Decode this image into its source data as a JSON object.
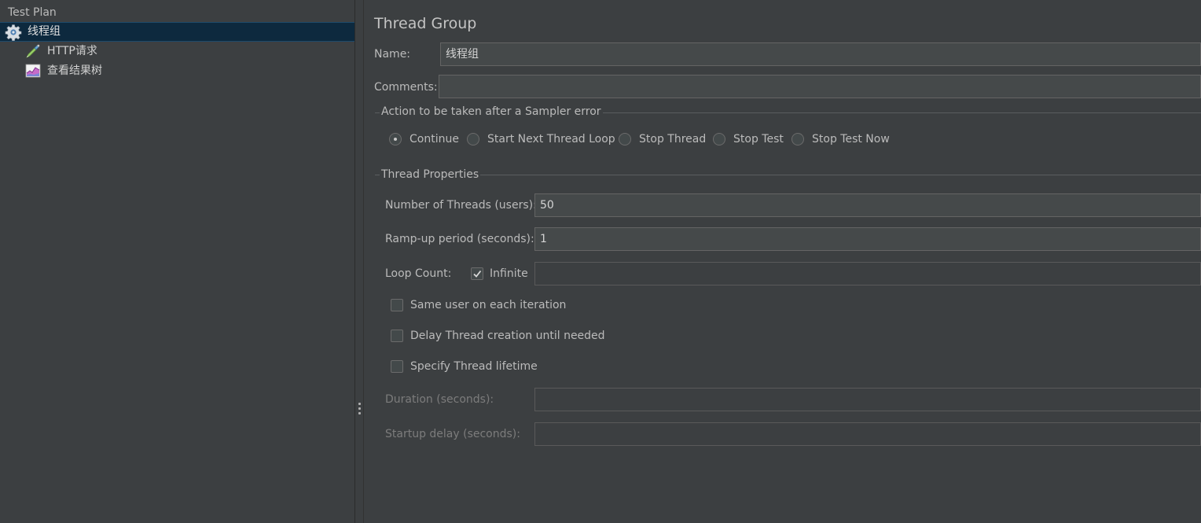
{
  "tree": {
    "root_label": "Test Plan",
    "items": [
      {
        "label": "线程组",
        "icon": "gear-icon"
      },
      {
        "label": "HTTP请求",
        "icon": "pipette-icon"
      },
      {
        "label": "查看结果树",
        "icon": "chart-icon"
      }
    ]
  },
  "panel": {
    "title": "Thread Group",
    "name_label": "Name:",
    "name_value": "线程组",
    "comments_label": "Comments:",
    "comments_value": "",
    "sampler_error": {
      "title": "Action to be taken after a Sampler error",
      "options": [
        "Continue",
        "Start Next Thread Loop",
        "Stop Thread",
        "Stop Test",
        "Stop Test Now"
      ],
      "selected": "Continue"
    },
    "thread_props": {
      "title": "Thread Properties",
      "threads_label": "Number of Threads (users):",
      "threads_value": "50",
      "rampup_label": "Ramp-up period (seconds):",
      "rampup_value": "1",
      "loop_label": "Loop Count:",
      "infinite_label": "Infinite",
      "infinite_checked": true,
      "loop_value": "",
      "same_user_label": "Same user on each iteration",
      "same_user_checked": false,
      "delay_label": "Delay Thread creation until needed",
      "delay_checked": false,
      "lifetime_label": "Specify Thread lifetime",
      "lifetime_checked": false,
      "duration_label": "Duration (seconds):",
      "duration_value": "",
      "startup_label": "Startup delay (seconds):",
      "startup_value": ""
    }
  },
  "colors": {
    "background": "#3c3f41",
    "selection": "#0d293e",
    "text": "#bbbbbb",
    "field_bg": "#45494a"
  }
}
